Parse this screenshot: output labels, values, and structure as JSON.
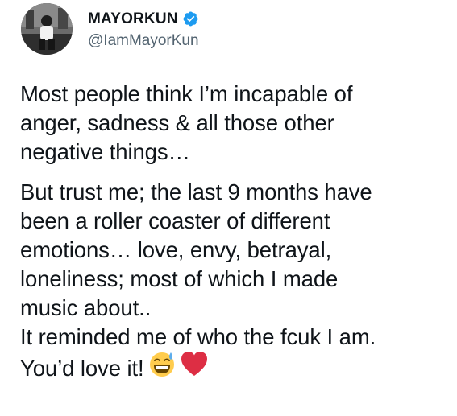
{
  "author": {
    "display_name": "MAYORKUN",
    "handle": "@IamMayorKun",
    "verified": true,
    "verified_icon": "verified-badge-icon",
    "brand_color": "#1d9bf0"
  },
  "tweet": {
    "paragraph_1": [
      "Most people think I’m incapable of",
      "anger, sadness & all those other",
      "negative things…"
    ],
    "paragraph_2": [
      "But trust me; the last 9 months have",
      "been a roller coaster of different",
      "emotions… love, envy, betrayal,",
      "loneliness; most of which I made",
      "music about..",
      "It reminded me of who the fcuk I am."
    ],
    "last_line": "You’d love it!",
    "emojis": [
      "sweat-smile-emoji-icon",
      "red-heart-emoji-icon"
    ]
  }
}
